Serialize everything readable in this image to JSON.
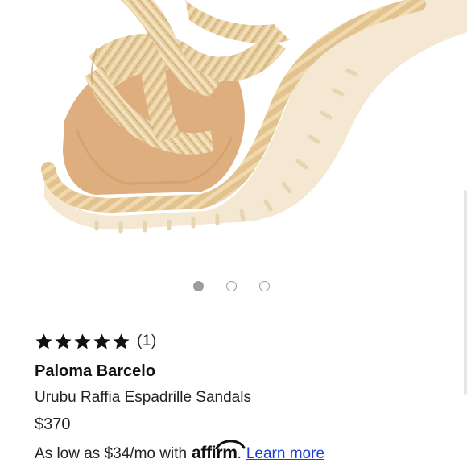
{
  "product": {
    "image_alt": "Paloma Barcelo Urubu Raffia Espadrille Sandals",
    "rating": 5,
    "rating_max": 5,
    "review_count": "(1)",
    "brand": "Paloma Barcelo",
    "name": "Urubu Raffia Espadrille Sandals",
    "price": "$370"
  },
  "carousel": {
    "total": 3,
    "active_index": 0
  },
  "financing": {
    "prefix": "As low as $34/mo with",
    "provider": "affirm",
    "suffix": ".",
    "link_label": "Learn more"
  },
  "colors": {
    "raffia": "#e6cc9c",
    "sole": "#f3e6cd",
    "footbed": "#deae7e",
    "star": "#111111",
    "link": "#1a3fd6",
    "dot_active": "#9c9c9c"
  },
  "icons": {
    "star": "star-icon",
    "affirm_arc": "affirm-arc-icon"
  }
}
